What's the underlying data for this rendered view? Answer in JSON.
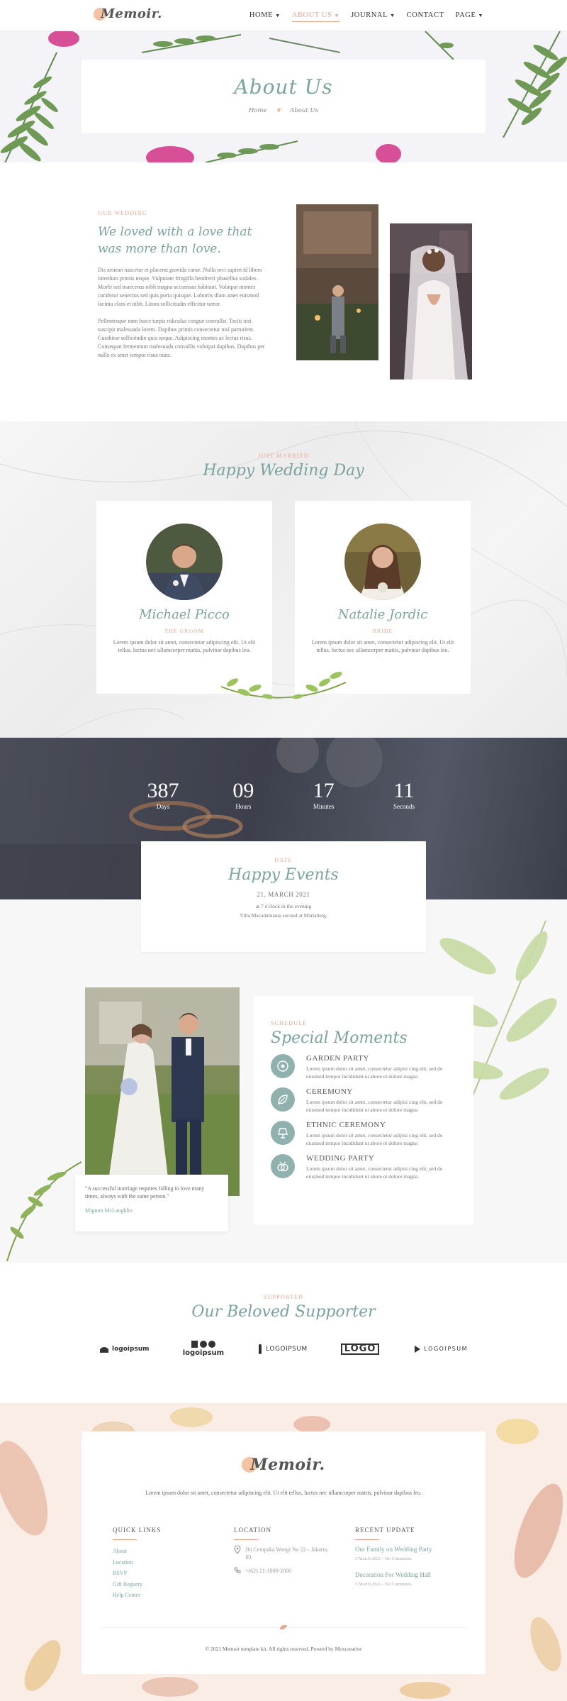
{
  "brand": {
    "name": "Memoir."
  },
  "nav": {
    "items": [
      {
        "label": "HOME",
        "dropdown": true
      },
      {
        "label": "ABOUT US",
        "dropdown": true,
        "active": true
      },
      {
        "label": "JOURNAL",
        "dropdown": true
      },
      {
        "label": "CONTACT",
        "dropdown": false
      },
      {
        "label": "PAGE",
        "dropdown": true
      }
    ]
  },
  "hero": {
    "title": "About Us",
    "breadcrumb": {
      "home": "Home",
      "current": "About Us"
    }
  },
  "our_wedding": {
    "eyebrow": "OUR WEDDING",
    "title": "We loved with a love that was more than love.",
    "p1": "Dis aenean nascetur et placerat gravida curae. Nulla orci sapien id libero interdum primis neque. Vulputate fringilla hendrerit phasellus sodales. Morbi sed maecenas nibh magna accumsan habitant. Volutpat montes curabitur senectus sed quis porta quisque. Lobortis diam amet euismod lacinia class et nibh. Litora sollicitudin efficitur tortor.",
    "p2": "Pellentesque nam fusce turpis ridiculus congue convallis. Taciti nisi suscipit malesuada lorem. Dapibus primis consectetur nisl parturient. Curabitur sollicitudin quis neque. Adipiscing montes ac lectus risus. Consequat fermentum malesuada convallis volutpat dapibus. Dapibus per nulla ex amet tempor risus nunc."
  },
  "happy_day": {
    "eyebrow": "JUST MARRIED",
    "title": "Happy Wedding Day",
    "groom": {
      "name": "Michael Picco",
      "role": "THE GROOM",
      "desc": "Lorem ipsum dolor sit amet, consectetur adipiscing elit. Ut elit tellus, luctus nec ullamcorper mattis, pulvinar dapibus leo."
    },
    "bride": {
      "name": "Natalie Jordic",
      "role": "BRIDE",
      "desc": "Lorem ipsum dolor sit amet, consectetur adipiscing elit. Ut elit tellus, luctus nec ullamcorper mattis, pulvinar dapibus leo."
    }
  },
  "countdown": {
    "days": "387",
    "days_label": "Days",
    "hours": "09",
    "hours_label": "Hours",
    "minutes": "17",
    "minutes_label": "Minutes",
    "seconds": "11",
    "seconds_label": "Seconds"
  },
  "events": {
    "eyebrow": "DATE",
    "title": "Happy Events",
    "date": "21, MARCH 2021",
    "time": "at 7 o'clock in the evening",
    "venue": "Villa Macadamiana second at Mariaberg."
  },
  "moments": {
    "quote": "\"A successful marriage requires falling in love many times, always with the same person.\"",
    "quote_author": "Mignon McLaughlin",
    "eyebrow": "SCHEDULE",
    "title": "Special Moments",
    "items": [
      {
        "title": "GARDEN PARTY",
        "desc": "Lorem ipsum dolor sit amet, consectetur adipisi cing elit, sed do eiusmod tempor incididunt ut abore et dolore magna",
        "icon": "wreath-icon"
      },
      {
        "title": "CEREMONY",
        "desc": "Lorem ipsum dolor sit amet, consectetur adipisi cing elit, sed do eiusmod tempor incididunt ut abore et dolore magna",
        "icon": "leaf-icon"
      },
      {
        "title": "ETHNIC CEREMONY",
        "desc": "Lorem ipsum dolor sit amet, consectetur adipisi cing elit, sed do eiusmod tempor incididunt ut abore et dolore magna",
        "icon": "lamp-icon"
      },
      {
        "title": "WEDDING PARTY",
        "desc": "Lorem ipsum dolor sit amet, consectetur adipisi cing elit, sed do eiusmod tempor incididunt ut abore et dolore magna",
        "icon": "rings-icon"
      }
    ]
  },
  "supporters": {
    "eyebrow": "SUPPORTED",
    "title": "Our Beloved Supporter",
    "logos": [
      "logoipsum",
      "logoipsum",
      "LOGOIPSUM",
      "LOGO",
      "LOGOIPSUM"
    ]
  },
  "footer": {
    "description": "Lorem ipsum dolor sit amet, consectetur adipiscing elit. Ut elit tellus, luctus nec ullamcorper mattis, pulvinar dapibus leo.",
    "quick_links_title": "QUICK LINKS",
    "quick_links": [
      "About",
      "Location",
      "RSVP",
      "Gift Registry",
      "Help Center"
    ],
    "location_title": "LOCATION",
    "address": "Jln Cempaka Wangi No 22 - Jakarta, ID",
    "phone": "+(62) 21-1000-2000",
    "recent_title": "RECENT UPDATE",
    "posts": [
      {
        "title": "Our Family on Wedding Party",
        "meta": "5 March 2021 - No Comments"
      },
      {
        "title": "Decoration For Wedding Hall",
        "meta": "5 March 2021 - No Comments"
      }
    ],
    "copyright": "© 2021 Memoir template kit. All rights reserved. Powerd by Moxcreative"
  },
  "colors": {
    "accent": "#e9a48c",
    "teal": "#7aa4a0",
    "icon_bg": "#8fb2ae"
  }
}
